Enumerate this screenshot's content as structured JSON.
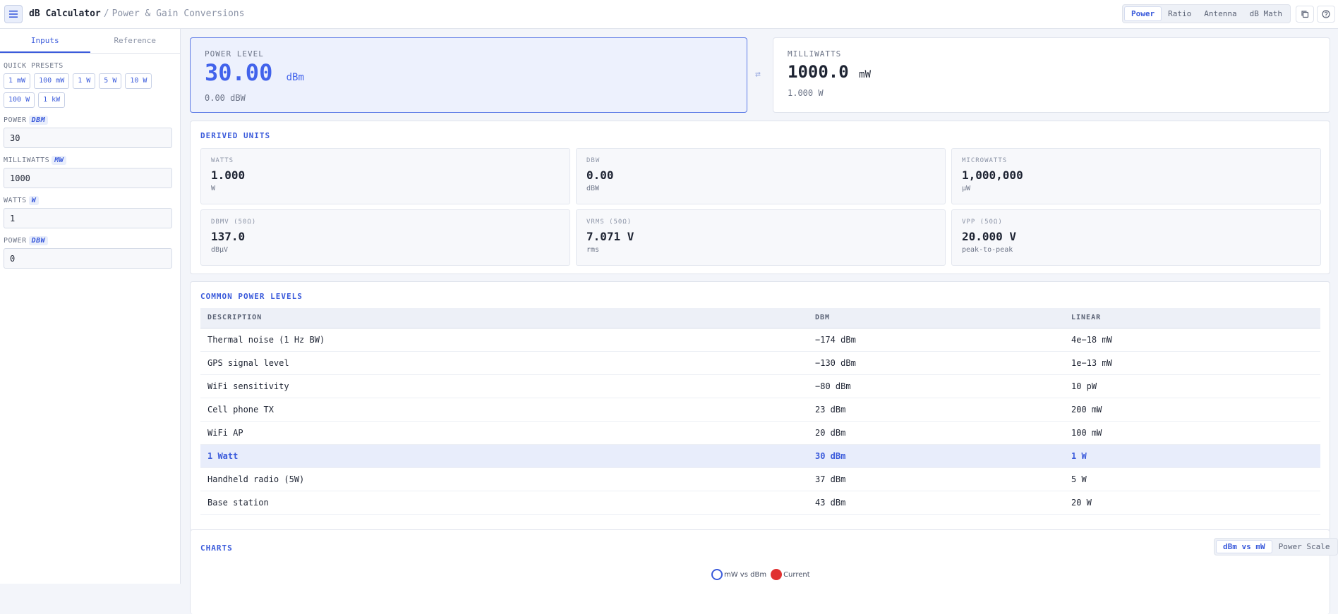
{
  "header": {
    "title": "dB Calculator",
    "separator": "/",
    "subtitle": "Power & Gain Conversions",
    "modes": [
      "Power",
      "Ratio",
      "Antenna",
      "dB Math"
    ],
    "active_mode": "Power"
  },
  "sidebar": {
    "tabs": [
      "Inputs",
      "Reference"
    ],
    "active_tab": "Inputs",
    "presets_label": "QUICK PRESETS",
    "presets": [
      "1 mW",
      "100 mW",
      "1 W",
      "5 W",
      "10 W",
      "100 W",
      "1 kW"
    ],
    "fields": [
      {
        "label": "POWER",
        "unit": "DBM",
        "value": "30"
      },
      {
        "label": "MILLIWATTS",
        "unit": "MW",
        "value": "1000"
      },
      {
        "label": "WATTS",
        "unit": "W",
        "value": "1"
      },
      {
        "label": "POWER",
        "unit": "DBW",
        "value": "0"
      }
    ]
  },
  "hero": {
    "left": {
      "label": "POWER LEVEL",
      "value": "30.00",
      "unit": "dBm",
      "sub": "0.00 dBW"
    },
    "swap_icon": "⇄",
    "right": {
      "label": "MILLIWATTS",
      "value": "1000.0",
      "unit": "mW",
      "sub": "1.000 W"
    }
  },
  "derived": {
    "title": "DERIVED UNITS",
    "tiles": [
      {
        "label": "WATTS",
        "value": "1.000",
        "unit": "W"
      },
      {
        "label": "DBW",
        "value": "0.00",
        "unit": "dBW"
      },
      {
        "label": "MICROWATTS",
        "value": "1,000,000",
        "unit": "µW"
      },
      {
        "label": "DBMV (50Ω)",
        "value": "137.0",
        "unit": "dBµV"
      },
      {
        "label": "VRMS (50Ω)",
        "value": "7.071 V",
        "unit": "rms"
      },
      {
        "label": "VPP (50Ω)",
        "value": "20.000 V",
        "unit": "peak-to-peak"
      }
    ]
  },
  "levels": {
    "title": "COMMON POWER LEVELS",
    "columns": [
      "DESCRIPTION",
      "DBM",
      "LINEAR"
    ],
    "rows": [
      [
        "Thermal noise (1 Hz BW)",
        "−174 dBm",
        "4e−18 mW"
      ],
      [
        "GPS signal level",
        "−130 dBm",
        "1e−13 mW"
      ],
      [
        "WiFi sensitivity",
        "−80 dBm",
        "10 pW"
      ],
      [
        "Cell phone TX",
        "23 dBm",
        "200 mW"
      ],
      [
        "WiFi AP",
        "20 dBm",
        "100 mW"
      ],
      [
        "1 Watt",
        "30 dBm",
        "1 W"
      ],
      [
        "Handheld radio (5W)",
        "37 dBm",
        "5 W"
      ],
      [
        "Base station",
        "43 dBm",
        "20 W"
      ]
    ],
    "highlight_row": 5
  },
  "charts": {
    "title": "CHARTS",
    "tabs": [
      "dBm vs mW",
      "Power Scale"
    ],
    "active_tab": "dBm vs mW",
    "legend": [
      {
        "name": "mW vs dBm",
        "color": "#3b5bdb"
      },
      {
        "name": "Current",
        "color": "#e03131"
      }
    ]
  },
  "colors": {
    "accent": "#3b5bdb",
    "highlight_bg": "#e8edfb",
    "current_marker": "#e03131"
  }
}
